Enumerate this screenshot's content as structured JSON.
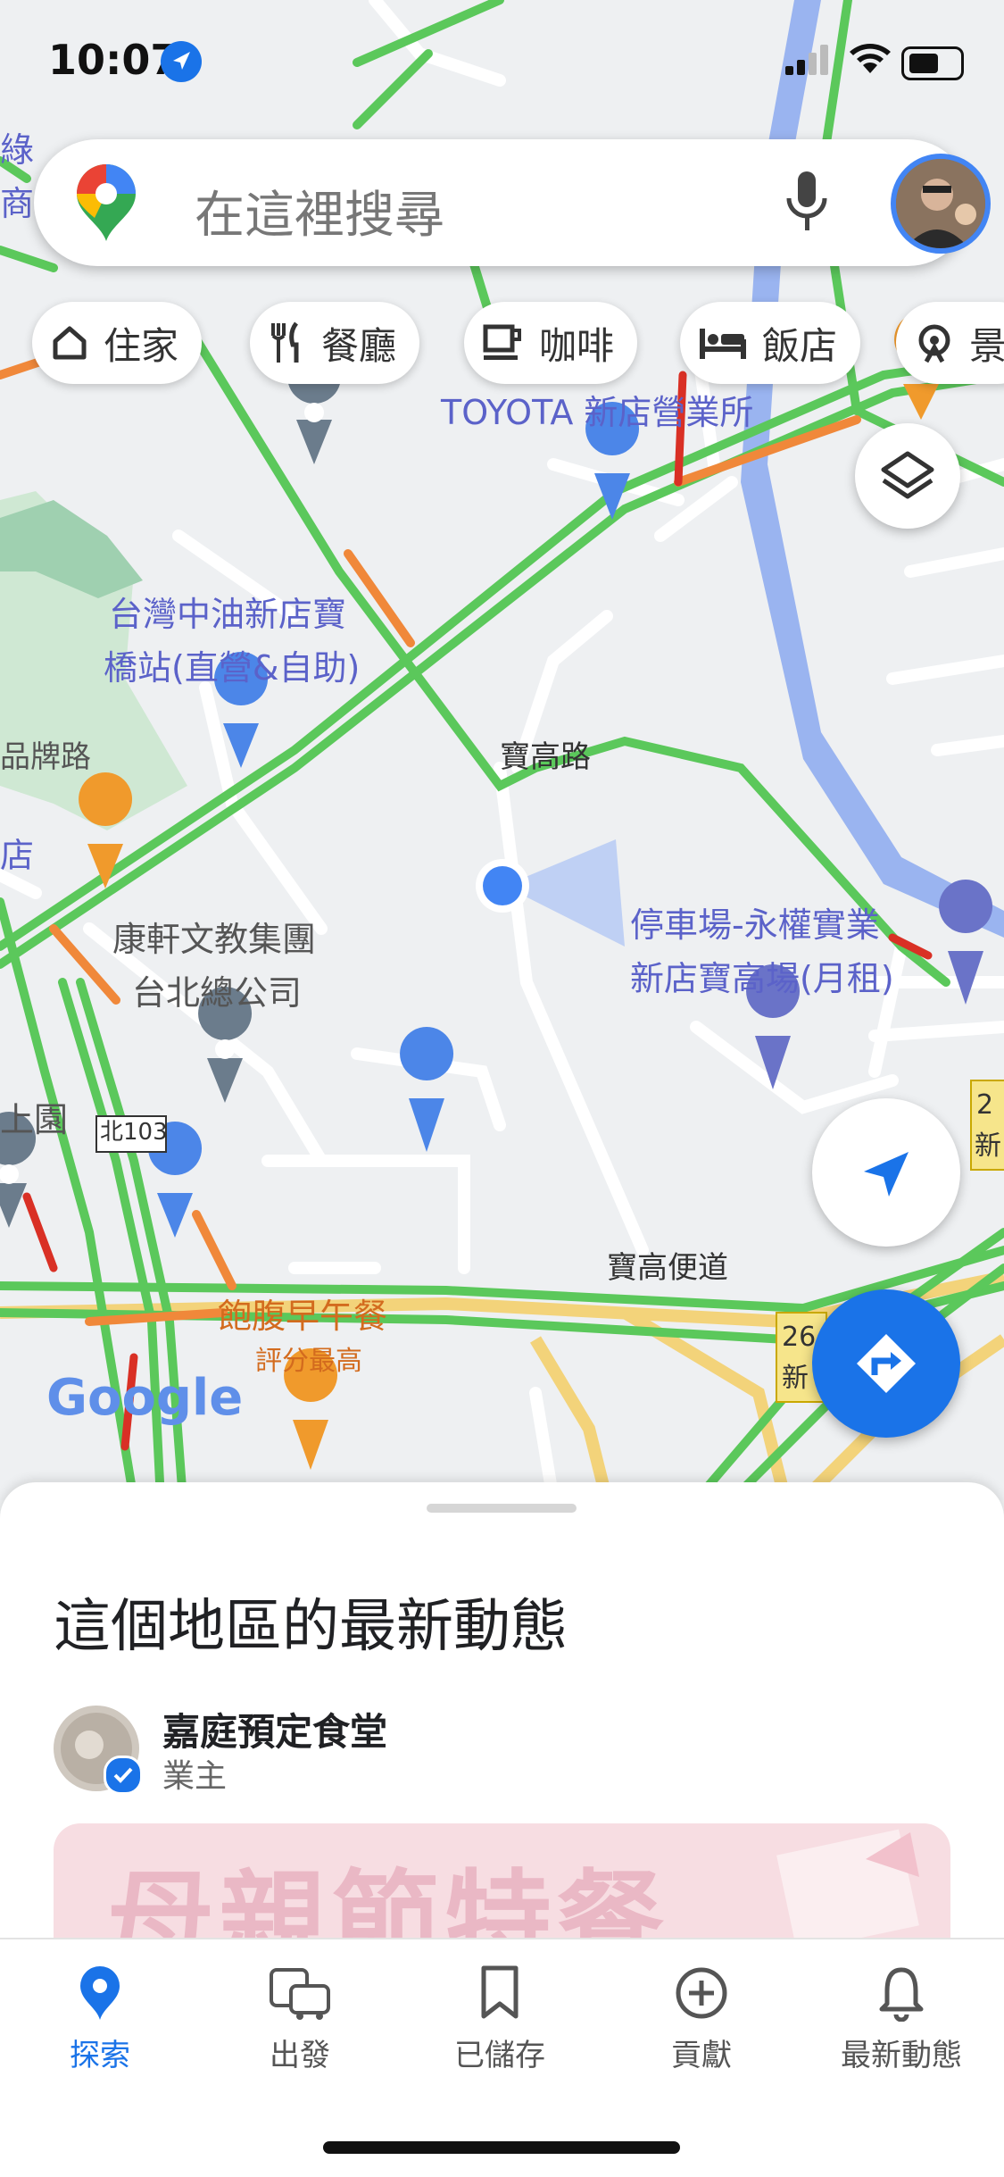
{
  "status_bar": {
    "time": "10:07"
  },
  "search": {
    "placeholder": "在這裡搜尋"
  },
  "chips": [
    {
      "label": "住家",
      "icon": "home-icon"
    },
    {
      "label": "餐廳",
      "icon": "restaurant-icon"
    },
    {
      "label": "咖啡",
      "icon": "coffee-icon"
    },
    {
      "label": "飯店",
      "icon": "hotel-icon"
    },
    {
      "label": "景",
      "icon": "attraction-icon"
    }
  ],
  "map": {
    "labels": {
      "toyota": "TOYOTA 新店營業所",
      "gas_station_1": "台灣中油新店寶",
      "gas_station_2": "橋站(直營&自助)",
      "road_baogao": "寶高路",
      "parking_1": "停車場-永權實業",
      "parking_2": "新店寶高場(月租)",
      "kangxuan_1": "康軒文教集團",
      "kangxuan_2": "台北總公司",
      "road_north103": "北103",
      "road_baogao_bypass": "寶高便道",
      "breakfast": "飽腹早午餐",
      "breakfast_sub": "評分最高",
      "left_pinpai": "品牌路",
      "left_store": "店",
      "left_garden": "上園",
      "top_left_1": "綠",
      "top_left_2": "商",
      "right_edge_1": "2",
      "right_edge_2": "新",
      "right_edge_3": "26",
      "right_edge_4": "新",
      "google": "Google"
    }
  },
  "sheet": {
    "title": "這個地區的最新動態",
    "poster_name": "嘉庭預定食堂",
    "poster_role": "業主",
    "post_image_text": "母親節特餐"
  },
  "nav": [
    {
      "label": "探索",
      "icon": "explore-pin-icon",
      "active": true
    },
    {
      "label": "出發",
      "icon": "commute-icon",
      "active": false
    },
    {
      "label": "已儲存",
      "icon": "bookmark-icon",
      "active": false
    },
    {
      "label": "貢獻",
      "icon": "add-circle-icon",
      "active": false
    },
    {
      "label": "最新動態",
      "icon": "bell-icon",
      "active": false
    }
  ],
  "colors": {
    "accent": "#1a73e8",
    "traffic_green": "#5bc85b",
    "traffic_orange": "#f0883a",
    "traffic_red": "#d93025",
    "river": "#9ab4f0"
  }
}
